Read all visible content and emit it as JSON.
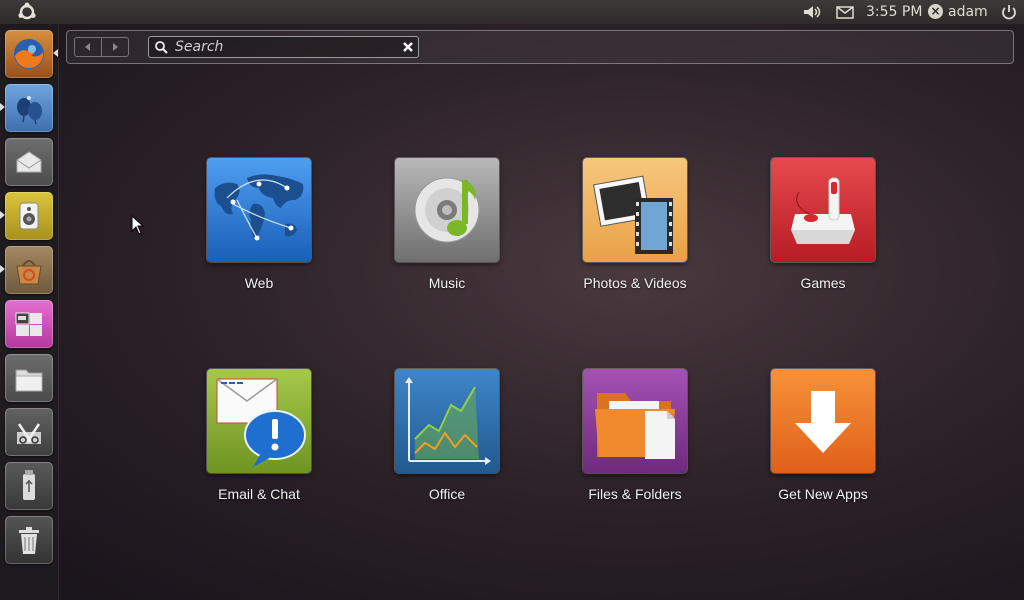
{
  "panel": {
    "clock": "3:55 PM",
    "user": "adam",
    "icons": [
      "ubuntu-logo",
      "sound-icon",
      "mail-icon",
      "power-icon"
    ]
  },
  "launcher": {
    "items": [
      {
        "name": "firefox",
        "icon": "firefox-icon",
        "running": true,
        "active": true
      },
      {
        "name": "empathy",
        "icon": "chat-balloons-icon",
        "running": true,
        "active": false
      },
      {
        "name": "mail",
        "icon": "envelope-icon",
        "running": false,
        "active": false
      },
      {
        "name": "music-player",
        "icon": "speaker-icon",
        "running": true,
        "active": false
      },
      {
        "name": "software-center",
        "icon": "software-center-icon",
        "running": true,
        "active": false
      },
      {
        "name": "workspaces",
        "icon": "workspace-switcher-icon",
        "running": false,
        "active": false
      },
      {
        "name": "files",
        "icon": "folder-icon",
        "running": false,
        "active": false
      },
      {
        "name": "settings",
        "icon": "tools-icon",
        "running": false,
        "active": false
      },
      {
        "name": "usb-drive",
        "icon": "usb-icon",
        "running": false,
        "active": false
      },
      {
        "name": "trash",
        "icon": "trash-icon",
        "running": false,
        "active": false
      }
    ]
  },
  "dash": {
    "search_placeholder": "Search",
    "search_value": "",
    "categories": [
      {
        "label": "Web",
        "icon": "globe-icon",
        "color": "#2f7fd6"
      },
      {
        "label": "Music",
        "icon": "music-cd-icon",
        "color": "#8f8f8f"
      },
      {
        "label": "Photos & Videos",
        "icon": "photos-videos-icon",
        "color": "#f1b25c"
      },
      {
        "label": "Games",
        "icon": "joystick-icon",
        "color": "#c8282e"
      },
      {
        "label": "Email & Chat",
        "icon": "email-chat-icon",
        "color": "#8fb03a"
      },
      {
        "label": "Office",
        "icon": "chart-icon",
        "color": "#2d6aa8"
      },
      {
        "label": "Files & Folders",
        "icon": "folder-icon",
        "color": "#8b3a9a"
      },
      {
        "label": "Get New Apps",
        "icon": "download-arrow-icon",
        "color": "#ee7a22"
      }
    ]
  }
}
